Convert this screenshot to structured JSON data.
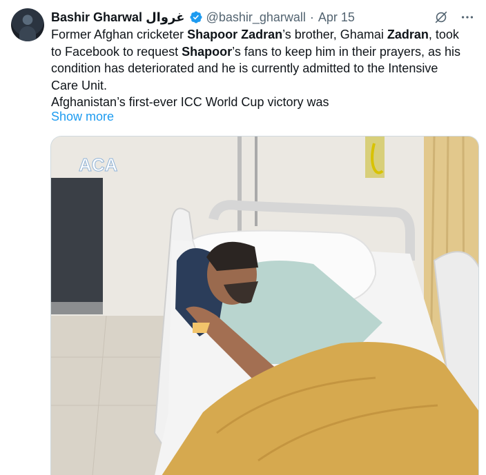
{
  "tweet": {
    "author_name": "Bashir Gharwal",
    "author_name_native": "غروال",
    "handle": "@bashir_gharwall",
    "separator": "·",
    "date": "Apr 15",
    "text": {
      "l1a": "Former Afghan cricketer ",
      "l1b": "Shapoor Zadran",
      "l1c": "’s brother, Ghamai ",
      "l1d": "Zadran",
      "l1e": ", took",
      "l2a": "to Facebook to request ",
      "l2b": "Shapoor",
      "l2c": "’s fans to keep him in their prayers, as his",
      "l3": "condition has deteriorated and he is currently admitted to the Intensive",
      "l4": "Care Unit.",
      "l5": "Afghanistan’s first-ever ICC World Cup victory was"
    },
    "show_more": "Show more",
    "media_watermark": "ACA",
    "icons": {
      "verified": "verified-badge-icon",
      "grok": "grok-icon",
      "more": "more-options-icon"
    }
  },
  "colors": {
    "text": "#0f1419",
    "secondary": "#536471",
    "link": "#1d9bf0",
    "border": "#cfd9de"
  }
}
